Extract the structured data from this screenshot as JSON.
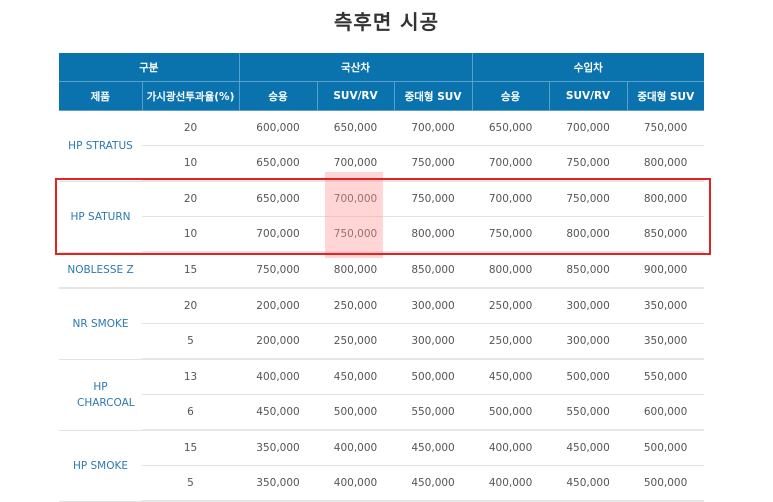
{
  "title": "측후면 시공",
  "header": {
    "group_category": "구분",
    "group_domestic": "국산차",
    "group_import": "수입차",
    "col_product": "제품",
    "col_vlt": "가시광선투과율(%)",
    "sub": [
      "승용",
      "SUV/RV",
      "중대형 SUV",
      "승용",
      "SUV/RV",
      "중대형 SUV"
    ]
  },
  "products": [
    {
      "name": "HP STRATUS",
      "rows": [
        {
          "vlt": "20",
          "prices": [
            "600,000",
            "650,000",
            "700,000",
            "650,000",
            "700,000",
            "750,000"
          ]
        },
        {
          "vlt": "10",
          "prices": [
            "650,000",
            "700,000",
            "750,000",
            "700,000",
            "750,000",
            "800,000"
          ]
        }
      ]
    },
    {
      "name": "HP SATURN",
      "rows": [
        {
          "vlt": "20",
          "prices": [
            "650,000",
            "700,000",
            "750,000",
            "700,000",
            "750,000",
            "800,000"
          ]
        },
        {
          "vlt": "10",
          "prices": [
            "700,000",
            "750,000",
            "800,000",
            "750,000",
            "800,000",
            "850,000"
          ]
        }
      ]
    },
    {
      "name": "NOBLESSE Z",
      "rows": [
        {
          "vlt": "15",
          "prices": [
            "750,000",
            "800,000",
            "850,000",
            "800,000",
            "850,000",
            "900,000"
          ]
        }
      ]
    },
    {
      "name": "NR SMOKE",
      "rows": [
        {
          "vlt": "20",
          "prices": [
            "200,000",
            "250,000",
            "300,000",
            "250,000",
            "300,000",
            "350,000"
          ]
        },
        {
          "vlt": "5",
          "prices": [
            "200,000",
            "250,000",
            "300,000",
            "250,000",
            "300,000",
            "350,000"
          ]
        }
      ]
    },
    {
      "name": "HP CHARCOAL",
      "rows": [
        {
          "vlt": "13",
          "prices": [
            "400,000",
            "450,000",
            "500,000",
            "450,000",
            "500,000",
            "550,000"
          ]
        },
        {
          "vlt": "6",
          "prices": [
            "450,000",
            "500,000",
            "550,000",
            "500,000",
            "550,000",
            "600,000"
          ]
        }
      ]
    },
    {
      "name": "HP SMOKE",
      "rows": [
        {
          "vlt": "15",
          "prices": [
            "350,000",
            "400,000",
            "450,000",
            "400,000",
            "450,000",
            "500,000"
          ]
        },
        {
          "vlt": "5",
          "prices": [
            "350,000",
            "400,000",
            "450,000",
            "400,000",
            "450,000",
            "500,000"
          ]
        }
      ]
    }
  ],
  "colors": {
    "header_bg": "#0a72ad",
    "product_text": "#2a7ab0",
    "highlight_box": "#e52222"
  }
}
